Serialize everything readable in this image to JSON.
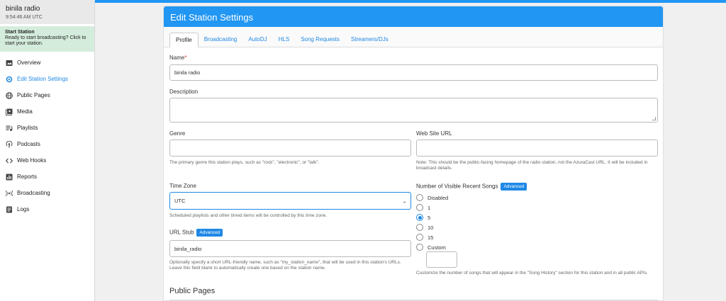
{
  "station": {
    "name": "binila radio",
    "time": "9:54:46 AM UTC"
  },
  "start": {
    "title": "Start Station",
    "desc": "Ready to start broadcasting? Click to start your station."
  },
  "nav": [
    {
      "label": "Overview",
      "icon": "image-icon"
    },
    {
      "label": "Edit Station Settings",
      "icon": "settings-icon",
      "active": true
    },
    {
      "label": "Public Pages",
      "icon": "globe-icon"
    },
    {
      "label": "Media",
      "icon": "media-icon"
    },
    {
      "label": "Playlists",
      "icon": "playlist-icon"
    },
    {
      "label": "Podcasts",
      "icon": "podcast-icon"
    },
    {
      "label": "Web Hooks",
      "icon": "code-icon"
    },
    {
      "label": "Reports",
      "icon": "chart-icon"
    },
    {
      "label": "Broadcasting",
      "icon": "broadcast-icon"
    },
    {
      "label": "Logs",
      "icon": "log-icon"
    }
  ],
  "card": {
    "title": "Edit Station Settings"
  },
  "tabs": [
    "Profile",
    "Broadcasting",
    "AutoDJ",
    "HLS",
    "Song Requests",
    "Streamers/DJs"
  ],
  "form": {
    "name_label": "Name",
    "name_required": "*",
    "name_value": "binila radio",
    "description_label": "Description",
    "genre_label": "Genre",
    "genre_help": "The primary genre this station plays, such as \"rock\", \"electronic\", or \"talk\".",
    "website_label": "Web Site URL",
    "website_help": "Note: This should be the public-facing homepage of the radio station, not the AzuraCast URL. It will be included in broadcast details.",
    "timezone_label": "Time Zone",
    "timezone_value": "UTC",
    "timezone_help": "Scheduled playlists and other timed items will be controlled by this time zone.",
    "urlstub_label": "URL Stub",
    "advanced_badge": "Advanced",
    "urlstub_value": "binila_radio",
    "urlstub_help": "Optionally specify a short URL-friendly name, such as \"my_station_name\", that will be used in this station's URLs. Leave this field blank to automatically create one based on the station name.",
    "recent_label": "Number of Visible Recent Songs",
    "recent_options": [
      "Disabled",
      "1",
      "5",
      "10",
      "15",
      "Custom"
    ],
    "recent_selected": "5",
    "recent_help": "Customize the number of songs that will appear in the \"Song History\" section for this station and in all public APIs."
  },
  "section": {
    "public_pages": "Public Pages"
  },
  "colors": {
    "accent": "#2196f3",
    "start_bg": "#d4ecdc",
    "link": "#1e88e5"
  }
}
